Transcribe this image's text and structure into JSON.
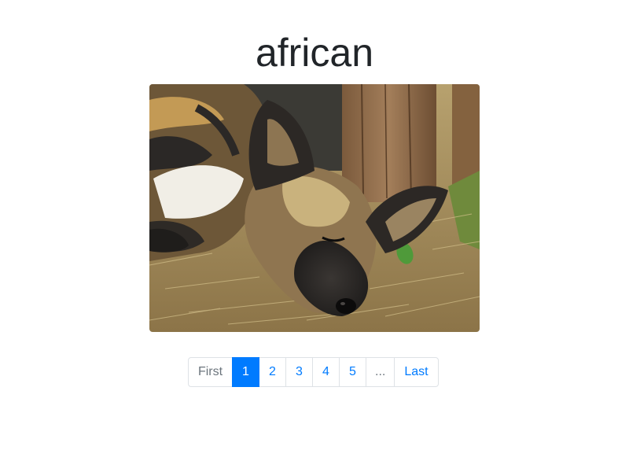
{
  "page": {
    "title": "african"
  },
  "image": {
    "subject": "sleeping african wild dog on straw"
  },
  "pagination": {
    "first_label": "First",
    "pages": [
      "1",
      "2",
      "3",
      "4",
      "5"
    ],
    "active_page": "1",
    "ellipsis_label": "...",
    "last_label": "Last"
  },
  "colors": {
    "accent": "#007bff",
    "text": "#212529",
    "muted": "#6c757d",
    "border": "#dee2e6"
  }
}
